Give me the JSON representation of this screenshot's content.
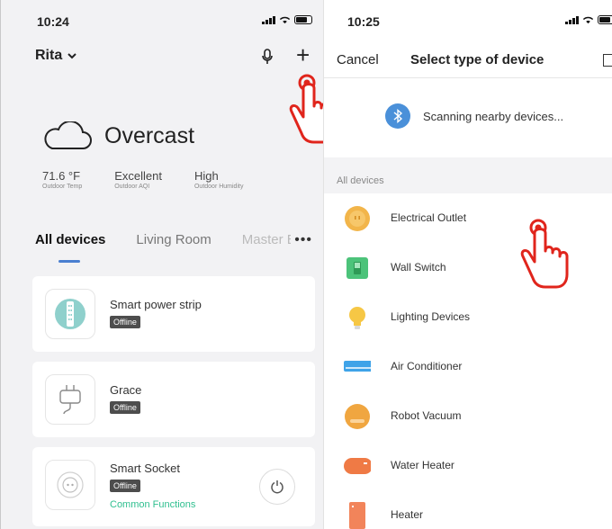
{
  "left": {
    "time": "10:24",
    "home_name": "Rita",
    "weather": {
      "label": "Overcast"
    },
    "stats": [
      {
        "value": "71.6 °F",
        "label": "Outdoor Temp"
      },
      {
        "value": "Excellent",
        "label": "Outdoor AQI"
      },
      {
        "value": "High",
        "label": "Outdoor Humidity"
      }
    ],
    "tabs": [
      "All devices",
      "Living Room",
      "Master B"
    ],
    "devices": [
      {
        "name": "Smart power strip",
        "status": "Offline"
      },
      {
        "name": "Grace",
        "status": "Offline"
      },
      {
        "name": "Smart Socket",
        "status": "Offline",
        "extra": "Common Functions"
      }
    ]
  },
  "right": {
    "time": "10:25",
    "nav": {
      "cancel": "Cancel",
      "title": "Select type of device"
    },
    "scanning": "Scanning nearby devices...",
    "section": "All devices",
    "device_types": [
      "Electrical Outlet",
      "Wall Switch",
      "Lighting Devices",
      "Air Conditioner",
      "Robot Vacuum",
      "Water Heater",
      "Heater"
    ]
  },
  "colors": {
    "accent": "#4a7fd0",
    "green": "#2fbf8f",
    "badge": "#4d4d4d",
    "hand": "#e0251c"
  }
}
